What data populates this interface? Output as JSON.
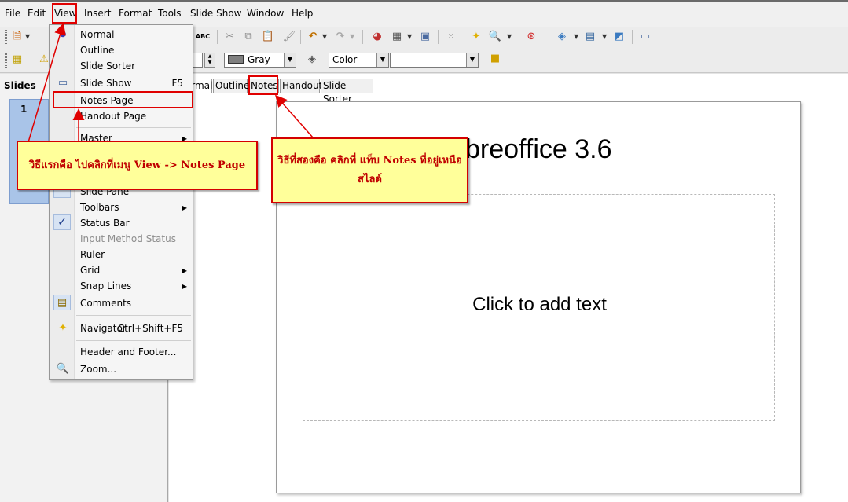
{
  "menubar": {
    "items": [
      "File",
      "Edit",
      "View",
      "Insert",
      "Format",
      "Tools",
      "Slide Show",
      "Window",
      "Help"
    ]
  },
  "toolbar2": {
    "line_width_partial": "n",
    "line_color": "Gray",
    "line_color_hex": "#808080",
    "area_style": "Color",
    "area_value": ""
  },
  "slides_panel": {
    "title": "Slides",
    "slide_number": "1"
  },
  "view_tabs": [
    "Normal",
    "Outline",
    "Notes",
    "Handout",
    "Slide Sorter"
  ],
  "slide": {
    "title_visible": "breoffice 3.6",
    "body_placeholder": "Click to add text"
  },
  "view_menu": {
    "items": [
      {
        "label": "Normal"
      },
      {
        "label": "Outline"
      },
      {
        "label": "Slide Sorter"
      },
      {
        "label": "Slide Show",
        "shortcut": "F5"
      },
      {
        "label": "Notes Page"
      },
      {
        "label": "Handout Page"
      },
      {
        "label": "Master"
      },
      {
        "label": "Slide Pane"
      },
      {
        "label": "Toolbars"
      },
      {
        "label": "Status Bar"
      },
      {
        "label": "Input Method Status"
      },
      {
        "label": "Ruler"
      },
      {
        "label": "Grid"
      },
      {
        "label": "Snap Lines"
      },
      {
        "label": "Comments"
      },
      {
        "label": "Navigator",
        "shortcut": "Ctrl+Shift+F5"
      },
      {
        "label": "Header and Footer..."
      },
      {
        "label": "Zoom..."
      }
    ]
  },
  "annotations": {
    "callout_left": "วิธีแรกคือ  ไปคลิกที่เมนู View -> Notes Page",
    "callout_right": "วิธีที่สองคือ คลิกที่ แท็บ Notes ที่อยู่เหนือสไลด์",
    "accent_color": "#e00000",
    "callout_bg": "#ffff9a"
  }
}
